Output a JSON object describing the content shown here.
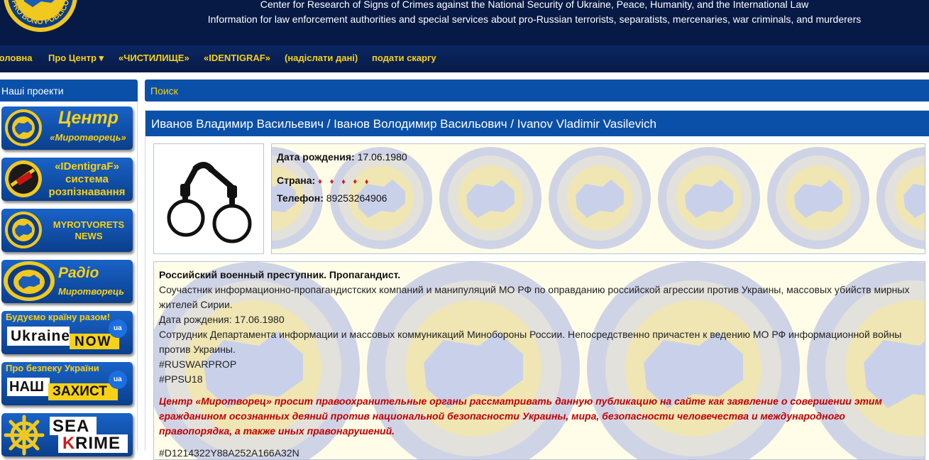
{
  "header": {
    "line1": "Center for Research of Signs of Crimes against the National Security of Ukraine, Peace, Humanity, and the International Law",
    "line2": "Information for law enforcement authorities and special services about pro-Russian terrorists, separatists, mercenaries, war criminals, and murderers",
    "logo_text": "PRO BONO PUBLICO"
  },
  "nav": {
    "items": [
      {
        "label": "Головна"
      },
      {
        "label": "Про Центр ▾"
      },
      {
        "label": "«ЧИСТИЛИЩЕ»"
      },
      {
        "label": "«IDENTIGRAF»"
      },
      {
        "label": "(надіслати дані)"
      },
      {
        "label": "подати скаргу"
      }
    ]
  },
  "sidebar": {
    "title": "Наші проекти",
    "tiles": {
      "center": {
        "big": "Центр",
        "small": "«Миротворець»"
      },
      "identigraf": {
        "line1": "«IDentigraF»",
        "line2": "система",
        "line3": "розпізнавання"
      },
      "news": {
        "line1": "MYROTVORETS",
        "line2": "NEWS"
      },
      "radio": {
        "big": "Радіо",
        "small": "Миротворець"
      },
      "ukraine_now": {
        "caption": "Будуємо країну разом!",
        "word1": "Ukraine",
        "word2": "NOW",
        "badge": "ua"
      },
      "zahist": {
        "caption": "Про безпеку України",
        "word1": "НАШ",
        "word2": "ЗАХИСТ",
        "badge": "ua"
      },
      "sea_krime": {
        "word1": "SEA",
        "word2a": "K",
        "word2b": "RIME"
      }
    }
  },
  "search": {
    "label": "Поиск"
  },
  "person": {
    "name": "Иванов Владимир Васильевич / Іванов Володимир Васильович / Ivanov Vladimir Vasilevich",
    "facts": {
      "birth_label": "Дата рождения:",
      "birth_value": "17.06.1980",
      "country_label": "Страна:",
      "country_value": "♦ ♦ ⬧ ♦ ⬧",
      "phone_label": "Телефон:",
      "phone_value": "89253264906"
    },
    "description": {
      "heading": "Российский военный преступник. Пропагандист.",
      "p1": "Соучастник информационно-пропагандистских компаний и манипуляций МО РФ по оправданию российской агрессии против Украины, массовых убийств мирных жителей Сирии.",
      "p2": "Дата рождения: 17.06.1980",
      "p3": "Сотрудник Департамента информации и массовых коммуникаций Минобороны России. Непосредственно причастен к ведению МО РФ информационной войны против Украины.",
      "tag1": "#RUSWARPROP",
      "tag2": "#PPSU18",
      "warning": "Центр «Миротворец» просит правоохранительные органы рассматривать данную публикацию на сайте как заявление о совершении этим гражданином осознанных деяний против национальной безопасности Украины, мира, безопасности человечества и международного правопорядка, а также иных правонарушений.",
      "hash": "#D1214322Y88A252A166A32N"
    }
  },
  "colors": {
    "header_bg": "#071a46",
    "accent_blue": "#0b50a8",
    "accent_yellow": "#f7d117",
    "warning_red": "#c00000",
    "panel_bg": "#fffde8"
  }
}
